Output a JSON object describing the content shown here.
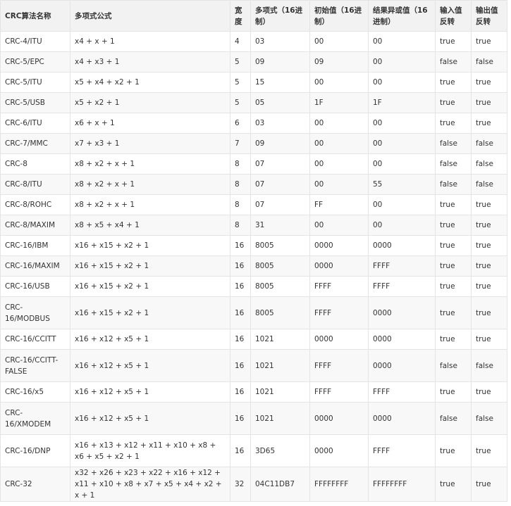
{
  "headers": [
    "CRC算法名称",
    "多项式公式",
    "宽度",
    "多项式（16进制）",
    "初始值（16进制）",
    "结果异或值（16进制）",
    "输入值反转",
    "输出值反转"
  ],
  "rows": [
    [
      "CRC-4/ITU",
      "x4 + x + 1",
      "4",
      "03",
      "00",
      "00",
      "true",
      "true"
    ],
    [
      "CRC-5/EPC",
      "x4 + x3 + 1",
      "5",
      "09",
      "09",
      "00",
      "false",
      "false"
    ],
    [
      "CRC-5/ITU",
      "x5 + x4 + x2 + 1",
      "5",
      "15",
      "00",
      "00",
      "true",
      "true"
    ],
    [
      "CRC-5/USB",
      "x5 + x2 + 1",
      "5",
      "05",
      "1F",
      "1F",
      "true",
      "true"
    ],
    [
      "CRC-6/ITU",
      "x6 + x + 1",
      "6",
      "03",
      "00",
      "00",
      "true",
      "true"
    ],
    [
      "CRC-7/MMC",
      "x7 + x3 + 1",
      "7",
      "09",
      "00",
      "00",
      "false",
      "false"
    ],
    [
      "CRC-8",
      "x8 + x2 + x + 1",
      "8",
      "07",
      "00",
      "00",
      "false",
      "false"
    ],
    [
      "CRC-8/ITU",
      "x8 + x2 + x + 1",
      "8",
      "07",
      "00",
      "55",
      "false",
      "false"
    ],
    [
      "CRC-8/ROHC",
      "x8 + x2 + x + 1",
      "8",
      "07",
      "FF",
      "00",
      "true",
      "true"
    ],
    [
      "CRC-8/MAXIM",
      "x8 + x5 + x4 + 1",
      "8",
      "31",
      "00",
      "00",
      "true",
      "true"
    ],
    [
      "CRC-16/IBM",
      "x16 + x15 + x2 + 1",
      "16",
      "8005",
      "0000",
      "0000",
      "true",
      "true"
    ],
    [
      "CRC-16/MAXIM",
      "x16 + x15 + x2 + 1",
      "16",
      "8005",
      "0000",
      "FFFF",
      "true",
      "true"
    ],
    [
      "CRC-16/USB",
      "x16 + x15 + x2 + 1",
      "16",
      "8005",
      "FFFF",
      "FFFF",
      "true",
      "true"
    ],
    [
      "CRC-16/MODBUS",
      "x16 + x15 + x2 + 1",
      "16",
      "8005",
      "FFFF",
      "0000",
      "true",
      "true"
    ],
    [
      "CRC-16/CCITT",
      "x16 + x12 + x5 + 1",
      "16",
      "1021",
      "0000",
      "0000",
      "true",
      "true"
    ],
    [
      "CRC-16/CCITT-FALSE",
      "x16 + x12 + x5 + 1",
      "16",
      "1021",
      "FFFF",
      "0000",
      "false",
      "false"
    ],
    [
      "CRC-16/x5",
      "x16 + x12 + x5 + 1",
      "16",
      "1021",
      "FFFF",
      "FFFF",
      "true",
      "true"
    ],
    [
      "CRC-16/XMODEM",
      "x16 + x12 + x5 + 1",
      "16",
      "1021",
      "0000",
      "0000",
      "false",
      "false"
    ],
    [
      "CRC-16/DNP",
      "x16 + x13 + x12 + x11 + x10 + x8 + x6 + x5 + x2 + 1",
      "16",
      "3D65",
      "0000",
      "FFFF",
      "true",
      "true"
    ],
    [
      "CRC-32",
      "x32 + x26 + x23 + x22 + x16 + x12 + x11 + x10 + x8 + x7 + x5 + x4 + x2 + x + 1",
      "32",
      "04C11DB7",
      "FFFFFFFF",
      "FFFFFFFF",
      "true",
      "true"
    ]
  ]
}
